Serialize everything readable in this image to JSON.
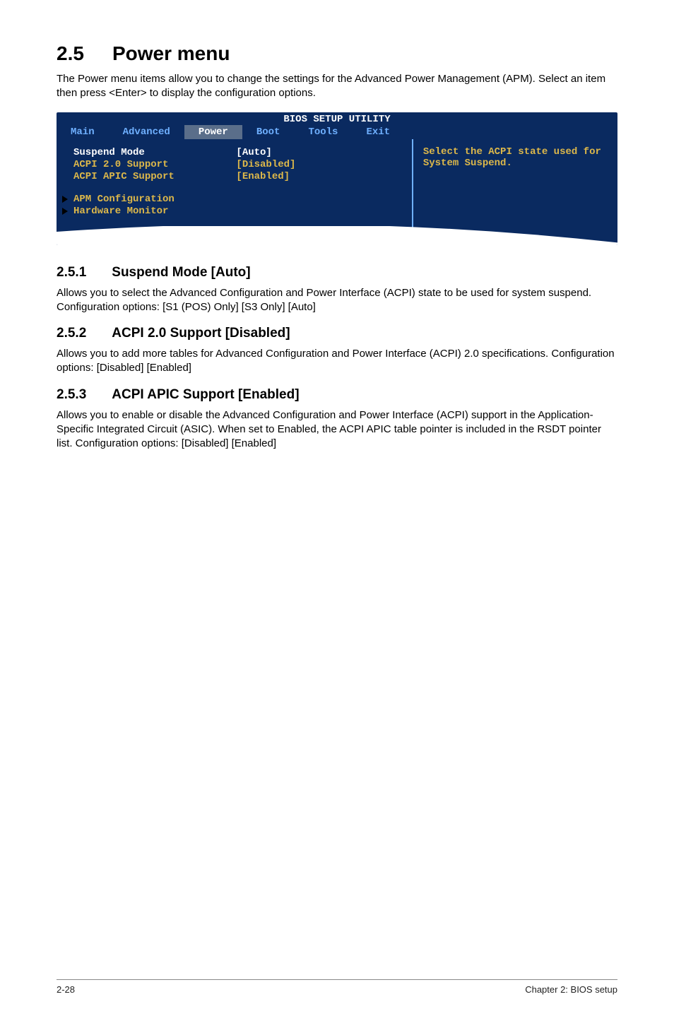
{
  "section": {
    "number": "2.5",
    "title": "Power menu",
    "intro": "The Power menu items allow you to change the settings for the Advanced Power Management (APM). Select an item then press <Enter> to display the configuration options."
  },
  "bios": {
    "header": "BIOS SETUP UTILITY",
    "tabs": {
      "main": "Main",
      "advanced": "Advanced",
      "power": "Power",
      "boot": "Boot",
      "tools": "Tools",
      "exit": "Exit"
    },
    "rows": {
      "suspend": {
        "label": "Suspend Mode",
        "value": "[Auto]"
      },
      "acpi20": {
        "label": "ACPI 2.0 Support",
        "value": "[Disabled]"
      },
      "acpiapic": {
        "label": "ACPI APIC Support",
        "value": "[Enabled]"
      }
    },
    "submenus": {
      "apm": "APM Configuration",
      "hw": "Hardware Monitor"
    },
    "help": "Select the ACPI state used for System Suspend."
  },
  "subsections": {
    "s1": {
      "number": "2.5.1",
      "title": "Suspend Mode [Auto]",
      "text": "Allows you to select the Advanced Configuration and Power Interface (ACPI) state to be used for system suspend. Configuration options: [S1 (POS) Only] [S3 Only] [Auto]"
    },
    "s2": {
      "number": "2.5.2",
      "title": "ACPI 2.0 Support [Disabled]",
      "text": "Allows you to add more tables for Advanced Configuration and Power Interface (ACPI) 2.0 specifications. Configuration options: [Disabled] [Enabled]"
    },
    "s3": {
      "number": "2.5.3",
      "title": "ACPI APIC Support [Enabled]",
      "text": "Allows you to enable or disable the Advanced Configuration and Power Interface (ACPI) support in the Application-Specific Integrated Circuit (ASIC). When set to Enabled, the ACPI APIC table pointer is included in the RSDT pointer list. Configuration options: [Disabled] [Enabled]"
    }
  },
  "footer": {
    "left": "2-28",
    "right": "Chapter 2: BIOS setup"
  }
}
